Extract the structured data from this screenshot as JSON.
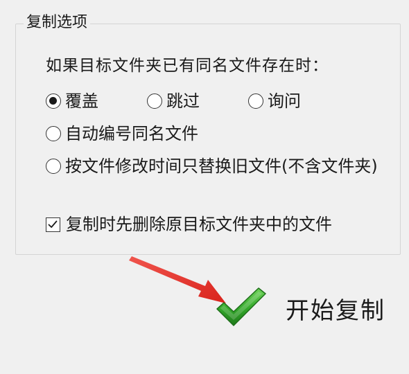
{
  "group": {
    "title": "复制选项"
  },
  "prompt": "如果目标文件夹已有同名文件存在时：",
  "options": {
    "overwrite": {
      "label": "覆盖",
      "checked": true
    },
    "skip": {
      "label": "跳过",
      "checked": false
    },
    "ask": {
      "label": "询问",
      "checked": false
    },
    "auto_number": {
      "label": "自动编号同名文件",
      "checked": false
    },
    "replace_old": {
      "label": "按文件修改时间只替换旧文件(不含文件夹)",
      "checked": false
    }
  },
  "delete_first": {
    "label": "复制时先删除原目标文件夹中的文件",
    "checked": true
  },
  "start": {
    "label": "开始复制"
  },
  "colors": {
    "arrow": "#e8312a",
    "check_green": "#3aa52e"
  }
}
